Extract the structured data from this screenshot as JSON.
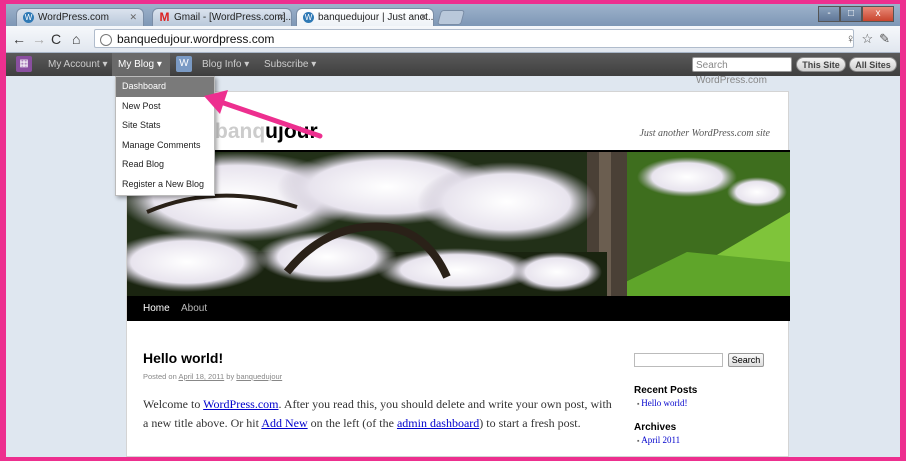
{
  "browser": {
    "tabs": [
      {
        "label": "WordPress.com",
        "icon": "wordpress-icon",
        "active": false
      },
      {
        "label": "Gmail - [WordPress.com]...",
        "icon": "gmail-icon",
        "active": false
      },
      {
        "label": "banquedujour | Just anot...",
        "icon": "wordpress-icon",
        "active": true
      }
    ],
    "url": "banquedujour.wordpress.com",
    "window_buttons": [
      "-",
      "□",
      "x"
    ]
  },
  "adminbar": {
    "my_account": "My Account ▾",
    "my_blog": "My Blog ▾",
    "blog_info": "Blog Info ▾",
    "subscribe": "Subscribe ▾",
    "search_placeholder": "Search WordPress.com",
    "this_site": "This Site",
    "all_sites": "All Sites"
  },
  "dropdown": {
    "items": [
      "Dashboard",
      "New Post",
      "Site Stats",
      "Manage Comments",
      "Read Blog",
      "Register a New Blog"
    ],
    "highlighted": "Dashboard"
  },
  "site": {
    "title_ghost": "banq",
    "title": "ujour",
    "tagline": "Just another WordPress.com site",
    "nav": [
      "Home",
      "About"
    ]
  },
  "post": {
    "title": "Hello world!",
    "meta_prefix": "Posted on",
    "date": "April 18, 2011",
    "meta_by": "by",
    "author": "banquedujour",
    "body_1": "Welcome to",
    "link_wp": "WordPress.com",
    "body_2": ". After you read this, you should delete and write your own post, with a new title above. Or hit",
    "link_addnew": "Add New",
    "body_3": "on the left (of the",
    "link_admin": "admin dashboard",
    "body_4": ") to start a fresh post."
  },
  "sidebar": {
    "search_button": "Search",
    "recent_posts_heading": "Recent Posts",
    "recent_posts": [
      "Hello world!"
    ],
    "archives_heading": "Archives",
    "archives": [
      "April 2011"
    ]
  },
  "colors": {
    "frame": "#ed2f8f",
    "annotation_arrow": "#ed2f8f"
  }
}
